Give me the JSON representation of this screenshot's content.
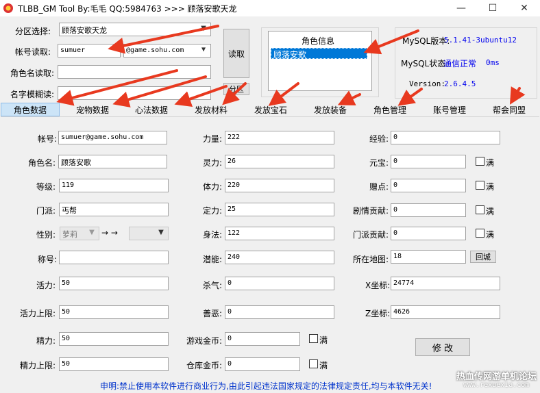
{
  "window": {
    "title": "TLBB_GM Tool By:毛毛 QQ:5984763 >>> 顾落安歌天龙",
    "icon": "app-icon",
    "controls": [
      "minimize-icon",
      "maximize-icon",
      "close-icon"
    ]
  },
  "top": {
    "server_label": "分区选择:",
    "server_value": "顾落安歌天龙",
    "account_label": "帐号读取:",
    "account_value": "sumuer",
    "domain_value": "@game.sohu.com",
    "role_read_label": "角色名读取:",
    "role_read_value": "",
    "fuzzy_label": "名字模糊读:",
    "fuzzy_value": "",
    "read_button": "读取",
    "zone_button": "分区"
  },
  "role_info": {
    "header": "角色信息",
    "items": [
      "顾落安歌"
    ]
  },
  "mysql": {
    "version_label": "MySQL版本:",
    "version_value": "5.1.41-3ubuntu12",
    "status_label": "MySQL状态:",
    "status_value": "通信正常",
    "status_ms": "0ms",
    "ver_label": "Version:",
    "ver_value": "2.6.4.5"
  },
  "tabs": [
    "角色数据",
    "宠物数据",
    "心法数据",
    "发放材料",
    "发放宝石",
    "发放装备",
    "角色管理",
    "账号管理",
    "帮会同盟"
  ],
  "col1": [
    {
      "label": "帐号:",
      "value": "sumuer@game.sohu.com"
    },
    {
      "label": "角色名:",
      "value": "顾落安歌"
    },
    {
      "label": "等级:",
      "value": "119"
    },
    {
      "label": "门派:",
      "value": "丐帮"
    },
    {
      "label": "称号:",
      "value": ""
    },
    {
      "label": "活力:",
      "value": "50"
    },
    {
      "label": "活力上限:",
      "value": "50"
    },
    {
      "label": "精力:",
      "value": "50"
    },
    {
      "label": "精力上限:",
      "value": "50"
    }
  ],
  "gender": {
    "label": "性别:",
    "value": "萝莉",
    "arrow_text": "→ →",
    "target_value": ""
  },
  "col2": [
    {
      "label": "力量:",
      "value": "222"
    },
    {
      "label": "灵力:",
      "value": "26"
    },
    {
      "label": "体力:",
      "value": "220"
    },
    {
      "label": "定力:",
      "value": "25"
    },
    {
      "label": "身法:",
      "value": "122"
    },
    {
      "label": "潜能:",
      "value": "240"
    },
    {
      "label": "杀气:",
      "value": "0"
    },
    {
      "label": "善恶:",
      "value": "0"
    },
    {
      "label": "游戏金币:",
      "value": "0"
    },
    {
      "label": "仓库金币:",
      "value": "0"
    }
  ],
  "col3": [
    {
      "label": "经验:",
      "value": "0"
    },
    {
      "label": "元宝:",
      "value": "0"
    },
    {
      "label": "赠点:",
      "value": "0"
    },
    {
      "label": "剧情贡献:",
      "value": "0"
    },
    {
      "label": "门派贡献:",
      "value": "0"
    },
    {
      "label": "所在地图:",
      "value": "18"
    },
    {
      "label": "X坐标:",
      "value": "24774"
    },
    {
      "label": "Z坐标:",
      "value": "4626"
    }
  ],
  "full_label": "满",
  "return_city_button": "回城",
  "modify_button": "修 改",
  "footer": {
    "notice": "申明:禁止使用本软件进行商业行为,由此引起违法国家规定的法律规定责任,均与本软件无关!",
    "watermark": "热血传网游单机论坛",
    "watermark_url": "www.rexuexia.com"
  },
  "colors": {
    "accent_blue": "#0000ee",
    "selection": "#0078d7",
    "arrow_red": "#e8391f",
    "tab_active": "#cce4f7"
  }
}
